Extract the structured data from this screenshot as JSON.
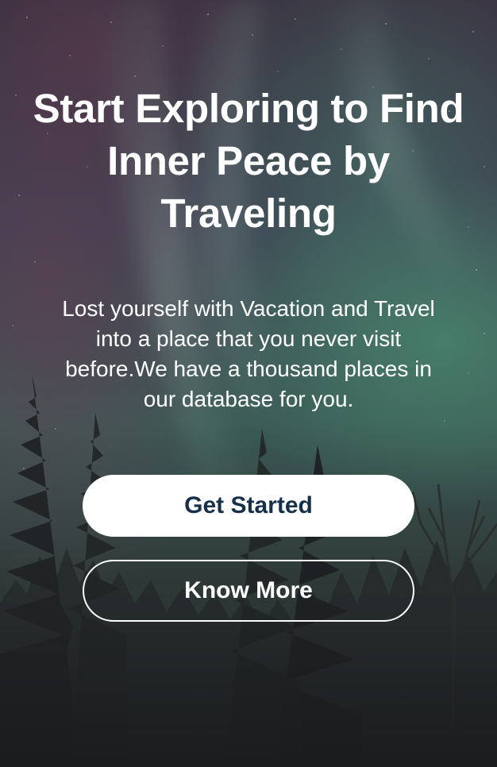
{
  "hero": {
    "headline": "Start Exploring to Find Inner Peace by Traveling",
    "tagline": "Lost yourself with Vacation and Travel into a place that you never visit before.We have a thousand places in our database for you."
  },
  "actions": {
    "primary_label": "Get Started",
    "secondary_label": "Know More"
  },
  "colors": {
    "text": "#ffffff",
    "primary_button_bg": "#ffffff",
    "primary_button_text": "#17304a",
    "secondary_button_border": "#ffffff"
  }
}
